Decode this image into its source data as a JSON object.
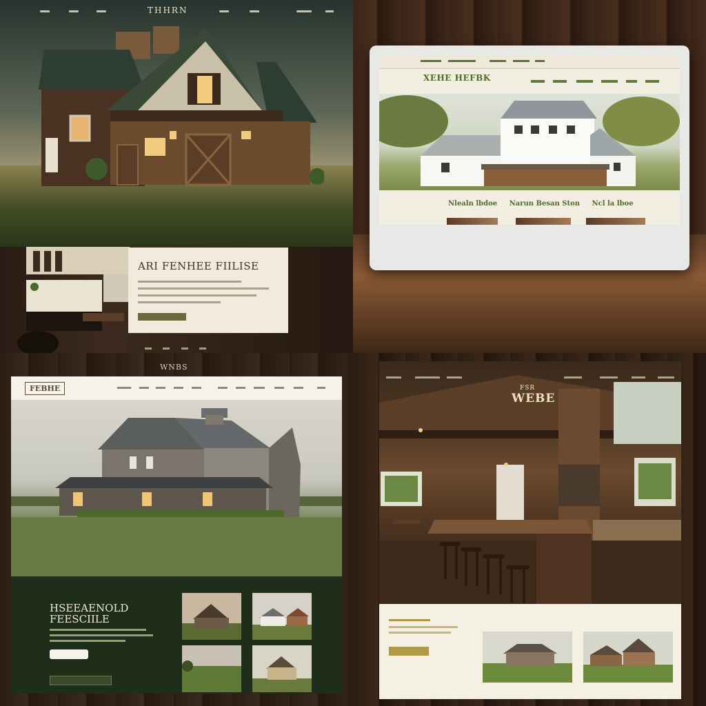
{
  "panel_top_left": {
    "site_title": "THHRN",
    "card_title": "ARI FENHEE FIILISE",
    "card_button": ""
  },
  "panel_top_right": {
    "site_title": "XEHE HEFBK",
    "feature_labels": [
      "Nlealn lbdoe",
      "Narun Besan Ston",
      "Ncl la lboe"
    ]
  },
  "panel_bottom_left": {
    "page_heading": "WNBS",
    "brand_badge": "FEBHE",
    "headline_line1": "HSEEAENOLD",
    "headline_line2": "FEESCIILE",
    "button_primary": "",
    "button_secondary": ""
  },
  "panel_bottom_right": {
    "brand_small": "FSR",
    "brand_large": "WEBE",
    "cta_button": ""
  },
  "colors": {
    "farm_green": "#2c3a22",
    "cream": "#f0ebdd",
    "wood_brown": "#3b2a1d",
    "accent_gold": "#b09a48",
    "link_green": "#4e6b28"
  }
}
